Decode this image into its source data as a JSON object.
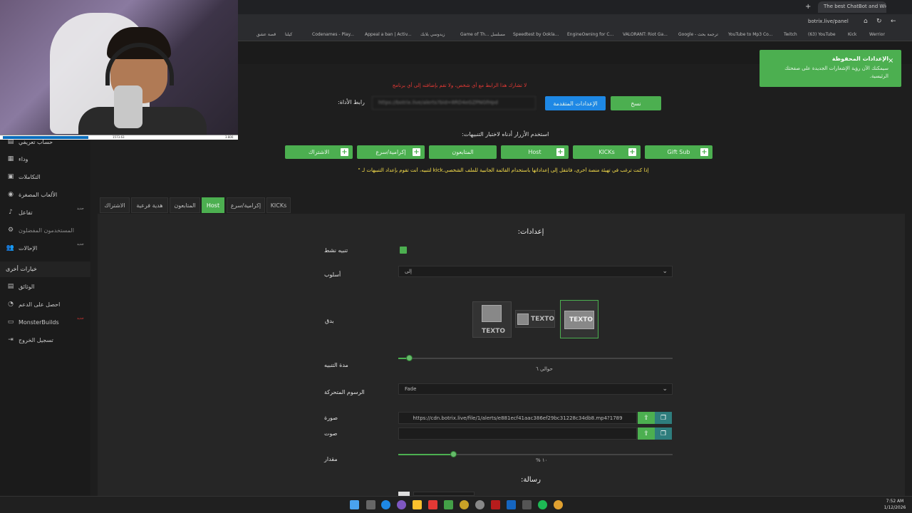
{
  "browser": {
    "tabs": [
      {
        "label": "The best ChatBot and Widgets"
      }
    ],
    "url": "botrix.live/panel",
    "bookmarks": [
      "قصة عشق",
      "كيلنا",
      "Codenames - Play...",
      "Appeal a ban | Activ...",
      "زيدوسي بلابك",
      "Game of Th... مسلسل",
      "Speedtest by Ookla...",
      "EngineOwning for C...",
      "VALORANT: Riot Ga...",
      "Google - ترجمة بحث",
      "YouTube to Mp3 Co...",
      "Twitch",
      "(63) YouTube",
      "Kick",
      "Werrior"
    ]
  },
  "webcam": {
    "bar_left": "1573.63",
    "bar_right": "3.800"
  },
  "toast": {
    "title": "الإعدادات المحفوظة",
    "body": "سيمكنك الآن رؤية الإشعارات الجديدة على صفحتك الرئيسية.",
    "close": "×"
  },
  "header": {
    "warning": "لا تشارك هذا الرابط مع أي شخص، ولا تقم بإضافته إلى أي برنامج",
    "url_label": "رابط الأداة:",
    "url_value": "https://botrix.live/alerts?bid=8RD4eGZPNGfHpd",
    "advanced_button": "الإعدادات المتقدمة",
    "copy_button": "نسخ"
  },
  "test_section": {
    "instruction": "استخدم الأزرار أدناه لاختبار التنبيهات:",
    "buttons": [
      {
        "label": "الاشتراك"
      },
      {
        "label": "إكرامية/سرع"
      },
      {
        "label": "المتابعون"
      },
      {
        "label": "Host"
      },
      {
        "label": "KICKs"
      },
      {
        "label": "Gift Sub"
      }
    ],
    "note": "إذا كنت ترغب في تهيئة منصة أخرى، فانتقل إلى إعداداتها باستخدام القائمة الجانبية للملف الشخصي.kick لتنبيه، أنت تقوم بإعداد التنبيهات لـ \""
  },
  "sidebar": {
    "items": [
      {
        "label": "حساب تعريفي",
        "icon": "id-card-icon"
      },
      {
        "label": "وداء",
        "icon": "grid-icon"
      },
      {
        "label": "التكاملات",
        "icon": "puzzle-icon"
      },
      {
        "label": "الألعاب المصغرة",
        "icon": "gamepad-icon"
      },
      {
        "label": "تفاعل",
        "icon": "music-icon",
        "badge": "جديد"
      },
      {
        "label": "المستخدمون المفضلون",
        "icon": "gear-icon"
      },
      {
        "label": "الإحالات",
        "icon": "users-icon",
        "badge": "جديد"
      }
    ],
    "other_heading": "خيارات أخرى",
    "other_items": [
      {
        "label": "الوثائق",
        "icon": "doc-icon"
      },
      {
        "label": "احصل على الدعم",
        "icon": "support-icon"
      },
      {
        "label": "MonsterBuilds",
        "icon": "monitor-icon",
        "badge": "جديد"
      },
      {
        "label": "تسجيل الخروج",
        "icon": "logout-icon"
      }
    ]
  },
  "tabs": [
    "KICKs",
    "إكرامية/سرع",
    "Host",
    "المتابعون",
    "هدية فرعية",
    "الاشتراك"
  ],
  "active_tab": "Host",
  "settings": {
    "heading": "إعدادات:",
    "active_label": "تنبيه نشط",
    "style_label": "أسلوب",
    "style_value": "إلى",
    "layout_label": "بدق",
    "layout_text": "TEXTO",
    "duration_label": "مدة التنبيه",
    "duration_value": "حوالي ٦",
    "duration_fraction": 0.04,
    "animation_label": "الرسوم المتحركة",
    "animation_value": "Fade",
    "image_label": "صورة",
    "image_value": "https://cdn.botrix.live/file/1/alerts/e881ecf41aac386ef29bc31228c34db8.mp4?1789",
    "sound_label": "صوت",
    "sound_value": "",
    "volume_label": "مقدار",
    "volume_value": "١٠ %",
    "volume_fraction": 0.2,
    "message_heading": "رسالة:"
  },
  "taskbar": {
    "time": "7:52 AM",
    "date": "1/12/2026"
  },
  "colors": {
    "accent": "#4caf50",
    "background": "#1e1e1e",
    "sidebar": "#1b1b1b"
  }
}
